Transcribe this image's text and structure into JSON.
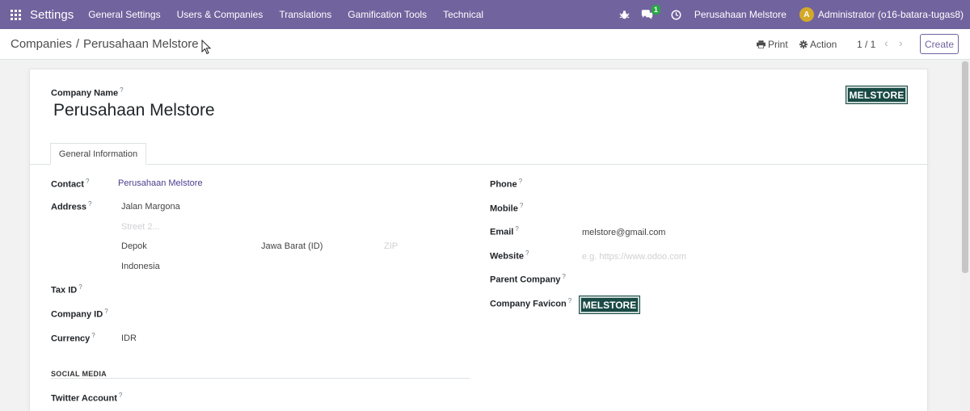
{
  "navbar": {
    "brand": "Settings",
    "menu": [
      "General Settings",
      "Users & Companies",
      "Translations",
      "Gamification Tools",
      "Technical"
    ],
    "messages_count": "1",
    "company": "Perusahaan Melstore",
    "avatar_letter": "A",
    "user": "Administrator (o16-batara-tugas8)",
    "color": "#71639e"
  },
  "control_panel": {
    "breadcrumb_parent": "Companies",
    "breadcrumb_separator": "/",
    "breadcrumb_current": "Perusahaan Melstore",
    "print_label": "Print",
    "action_label": "Action",
    "pager": "1 / 1",
    "create_label": "Create"
  },
  "form": {
    "company_name_label": "Company Name",
    "company_name": "Perusahaan Melstore",
    "logo_text": "MELSTORE",
    "tab_general": "General Information",
    "help_mark": "?",
    "left": {
      "contact_label": "Contact",
      "contact_value": "Perusahaan Melstore",
      "address_label": "Address",
      "street": "Jalan Margona",
      "street2_placeholder": "Street 2...",
      "city": "Depok",
      "state": "Jawa Barat (ID)",
      "zip_placeholder": "ZIP",
      "country": "Indonesia",
      "tax_id_label": "Tax ID",
      "company_id_label": "Company ID",
      "currency_label": "Currency",
      "currency_value": "IDR",
      "social_media_title": "SOCIAL MEDIA",
      "twitter_label": "Twitter Account"
    },
    "right": {
      "phone_label": "Phone",
      "mobile_label": "Mobile",
      "email_label": "Email",
      "email_value": "melstore@gmail.com",
      "website_label": "Website",
      "website_placeholder": "e.g. https://www.odoo.com",
      "parent_company_label": "Parent Company",
      "favicon_label": "Company Favicon",
      "favicon_text": "MELSTORE"
    }
  }
}
